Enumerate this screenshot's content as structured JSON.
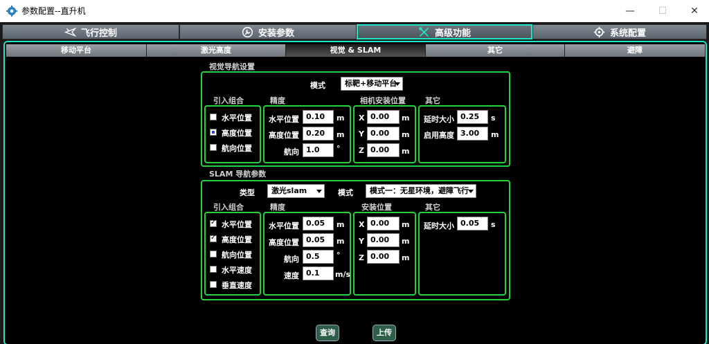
{
  "window": {
    "title": "参数配置--直升机",
    "minimize": "—",
    "maximize": "☐",
    "close": "✕"
  },
  "main_tabs": [
    "飞行控制",
    "安装参数",
    "高级功能",
    "系统配置"
  ],
  "sub_tabs": [
    "移动平台",
    "激光高度",
    "视觉 & SLAM",
    "其它",
    "避障"
  ],
  "vision": {
    "title": "视觉导航设置",
    "mode_label": "模式",
    "mode_value": "标靶+移动平台",
    "col_combo": "引入组合",
    "col_precision": "精度",
    "col_camera": "相机安装位置",
    "col_other": "其它",
    "combo": [
      {
        "label": "水平位置",
        "state": "off"
      },
      {
        "label": "高度位置",
        "state": "partial"
      },
      {
        "label": "航向位置",
        "state": "off"
      }
    ],
    "precision": [
      {
        "label": "水平位置",
        "value": "0.10",
        "unit": "m"
      },
      {
        "label": "高度位置",
        "value": "0.20",
        "unit": "m"
      },
      {
        "label": "航向",
        "value": "1.0",
        "unit": "°"
      }
    ],
    "camera": [
      {
        "axis": "X",
        "value": "0.00",
        "unit": "m"
      },
      {
        "axis": "Y",
        "value": "0.00",
        "unit": "m"
      },
      {
        "axis": "Z",
        "value": "0.00",
        "unit": "m"
      }
    ],
    "other": [
      {
        "label": "延时大小",
        "value": "0.25",
        "unit": "s"
      },
      {
        "label": "启用高度",
        "value": "3.00",
        "unit": "m"
      }
    ]
  },
  "slam": {
    "title": "SLAM 导航参数",
    "type_label": "类型",
    "type_value": "激光slam",
    "mode_label": "模式",
    "mode_value": "模式一：无星环境，避障飞行",
    "col_combo": "引入组合",
    "col_precision": "精度",
    "col_install": "安装位置",
    "col_other": "其它",
    "combo": [
      {
        "label": "水平位置",
        "state": "on"
      },
      {
        "label": "高度位置",
        "state": "on"
      },
      {
        "label": "航向位置",
        "state": "off"
      },
      {
        "label": "水平速度",
        "state": "off"
      },
      {
        "label": "垂直速度",
        "state": "off"
      }
    ],
    "precision": [
      {
        "label": "水平位置",
        "value": "0.05",
        "unit": "m"
      },
      {
        "label": "高度位置",
        "value": "0.05",
        "unit": "m"
      },
      {
        "label": "航向",
        "value": "0.5",
        "unit": "°"
      },
      {
        "label": "速度",
        "value": "0.1",
        "unit": "m/s"
      }
    ],
    "install": [
      {
        "axis": "X",
        "value": "0.00",
        "unit": "m"
      },
      {
        "axis": "Y",
        "value": "0.00",
        "unit": "m"
      },
      {
        "axis": "Z",
        "value": "0.00",
        "unit": "m"
      }
    ],
    "other": [
      {
        "label": "延时大小",
        "value": "0.05",
        "unit": "s"
      }
    ]
  },
  "buttons": {
    "query": "查询",
    "upload": "上传"
  },
  "colors": {
    "accent_tab": "#1ee6c8",
    "group_border": "#22d43a",
    "background": "#000000"
  },
  "icons": [
    "app-gear-icon",
    "plane-icon",
    "wrench-icon",
    "tools-icon",
    "gear-icon"
  ]
}
